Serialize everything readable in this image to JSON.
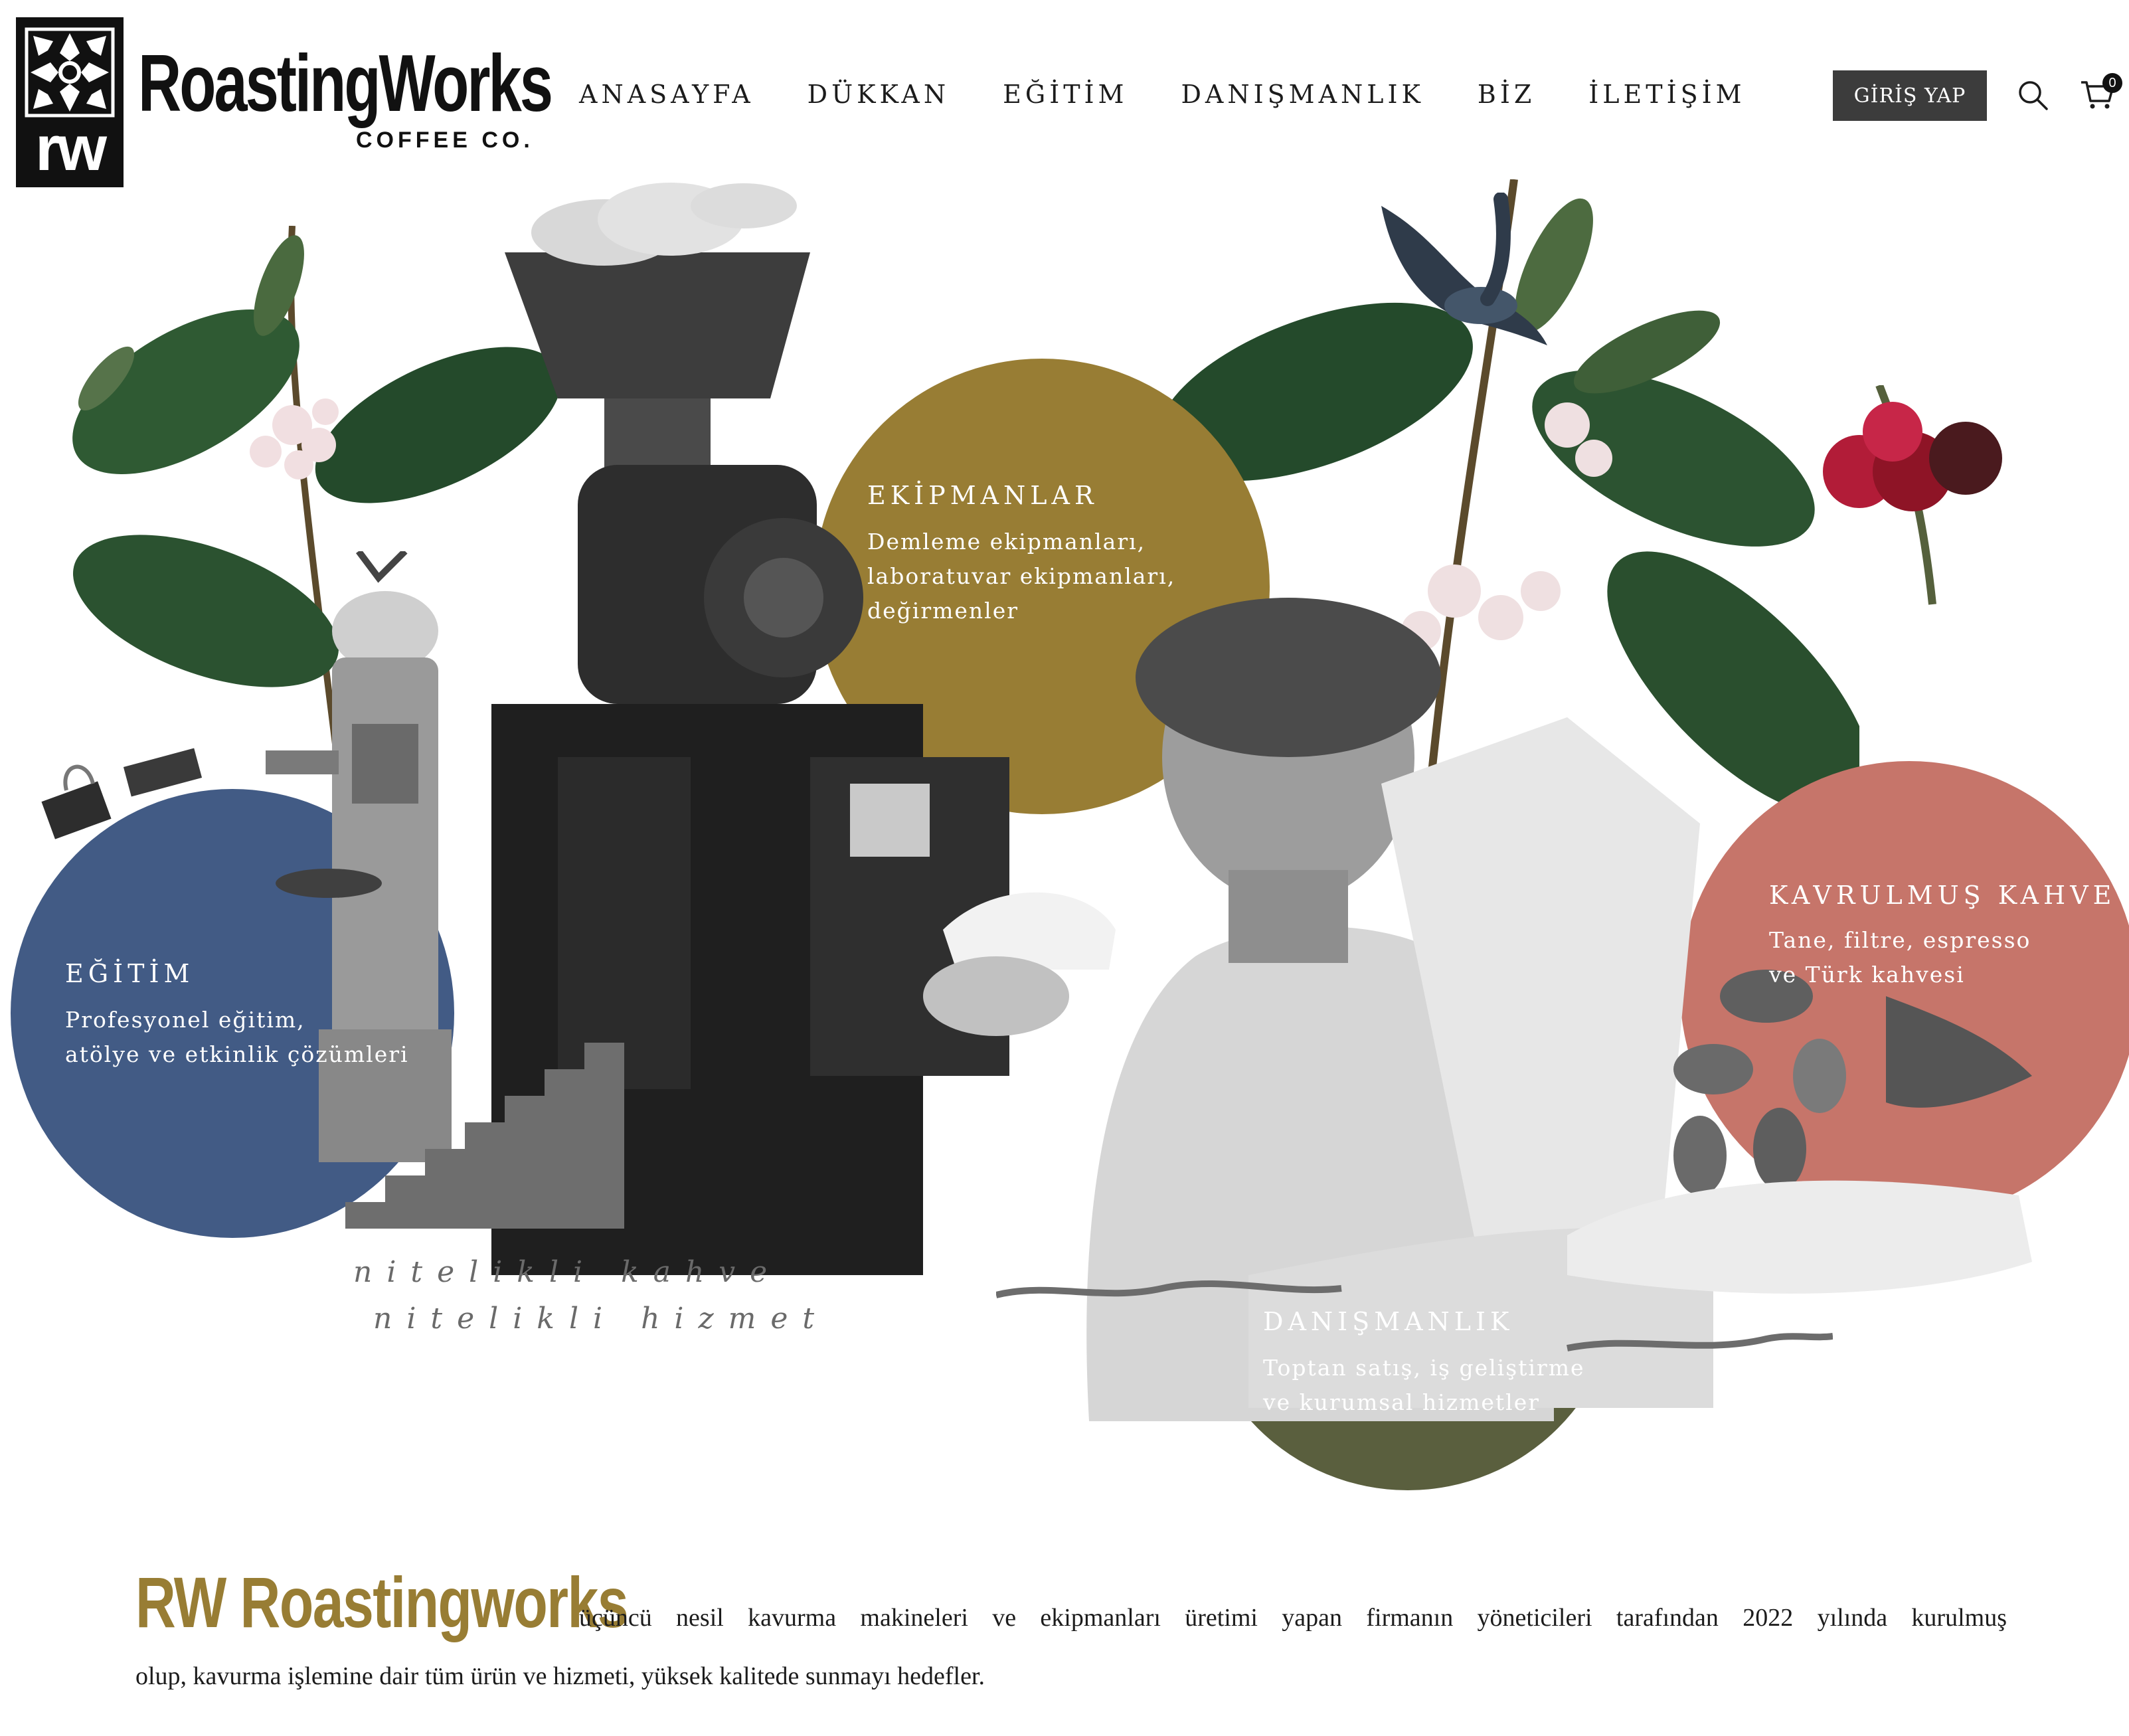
{
  "brand": {
    "name": "RoastingWorks",
    "sub": "COFFEE CO.",
    "mark": "rw"
  },
  "nav": {
    "items": [
      "ANASAYFA",
      "DÜKKAN",
      "EĞİTİM",
      "DANIŞMANLIK",
      "BİZ",
      "İLETİŞİM"
    ]
  },
  "header": {
    "login_label": "GİRİŞ YAP",
    "cart_count": "0",
    "icons": [
      "search-icon",
      "cart-icon"
    ]
  },
  "sections": {
    "egitim": {
      "title": "EĞİTİM",
      "lines": [
        "Profesyonel eğitim,",
        "atölye ve etkinlik çözümleri"
      ],
      "color": "#425b85"
    },
    "ekipmanlar": {
      "title": "EKİPMANLAR",
      "lines": [
        "Demleme ekipmanları,",
        "laboratuvar ekipmanları,",
        "değirmenler"
      ],
      "color": "#987d34"
    },
    "kavrulmus": {
      "title": "KAVRULMUŞ KAHVE",
      "lines": [
        "Tane, filtre, espresso",
        "ve Türk kahvesi"
      ],
      "color": "#c6756a"
    },
    "danismanlik": {
      "title": "DANIŞMANLIK",
      "lines": [
        "Toptan satış, iş geliştirme",
        "ve kurumsal hizmetler"
      ],
      "color": "#5a5f3e"
    }
  },
  "tagline": [
    "nitelikli kahve",
    "nitelikli hizmet"
  ],
  "about": {
    "brand": "RW Roastingworks",
    "line1": "üçüncü nesil kavurma makineleri ve ekipmanları üretimi yapan firmanın yöneticileri tarafından 2022 yılında kurulmuş",
    "line2": "olup, kavurma işlemine dair tüm ürün ve hizmeti, yüksek kalitede sunmayı hedefler."
  }
}
